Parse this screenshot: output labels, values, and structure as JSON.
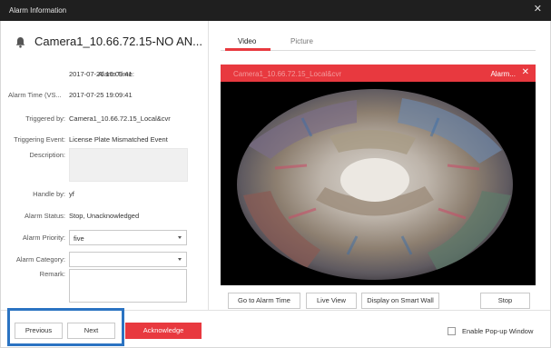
{
  "window": {
    "title": "Alarm Information",
    "close_glyph": "✕"
  },
  "header": {
    "camera_title": "Camera1_10.66.72.15-NO AN...",
    "icon": "bell-icon"
  },
  "details": {
    "alarm_time_label": "Alarm Time:",
    "alarm_time_value": "2017-07-26 10:09:41",
    "alarm_time_vs_label": "Alarm Time (VS...",
    "alarm_time_vs_value": "2017-07-25 19:09:41",
    "triggered_by_label": "Triggered by:",
    "triggered_by_value": "Camera1_10.66.72.15_Local&cvr",
    "triggering_event_label": "Triggering Event:",
    "triggering_event_value": "License Plate Mismatched Event",
    "description_label": "Description:",
    "handle_by_label": "Handle by:",
    "handle_by_value": "yf",
    "alarm_status_label": "Alarm Status:",
    "alarm_status_value": "Stop, Unacknowledged",
    "alarm_priority_label": "Alarm Priority:",
    "alarm_priority_value": "five",
    "alarm_category_label": "Alarm Category:",
    "alarm_category_value": "",
    "remark_label": "Remark:"
  },
  "tabs": [
    {
      "label": "Video",
      "active": true
    },
    {
      "label": "Picture",
      "active": false
    }
  ],
  "video": {
    "header_camera": "Camera1_10.66.72.15_Local&cvr",
    "header_alarm": "Alarm...",
    "header_close": "✕",
    "accent_color": "#e8393f"
  },
  "video_buttons": {
    "go_to_alarm_time": "Go to Alarm Time",
    "live_view": "Live View",
    "display_on_smart_wall": "Display on Smart Wall",
    "stop": "Stop"
  },
  "footer": {
    "previous": "Previous",
    "next": "Next",
    "acknowledge": "Acknowledge",
    "enable_popup_label": "Enable Pop-up Window",
    "enable_popup_checked": false,
    "highlight_color": "#2b73c2"
  }
}
